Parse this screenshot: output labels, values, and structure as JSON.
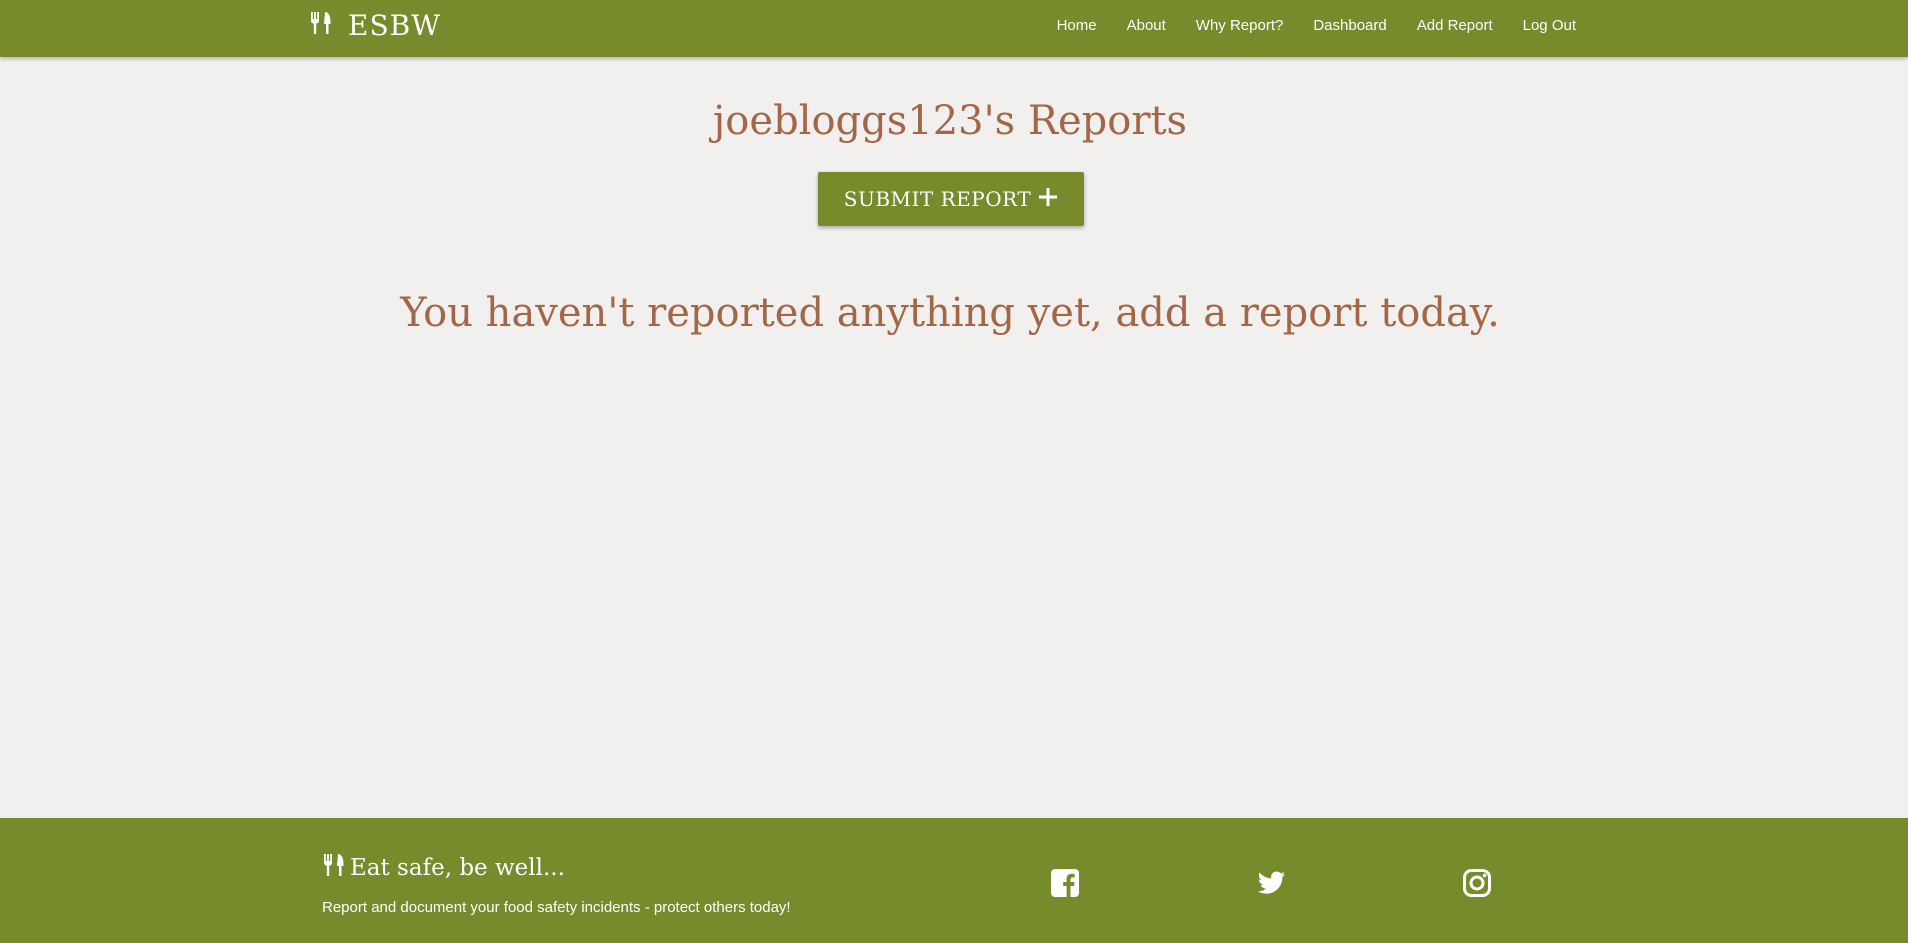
{
  "navbar": {
    "brand_icon": "utensils-icon",
    "brand": "ESBW",
    "links": [
      "Home",
      "About",
      "Why Report?",
      "Dashboard",
      "Add Report",
      "Log Out"
    ]
  },
  "main": {
    "title": "joebloggs123's Reports",
    "submit_label": "SUBMIT REPORT",
    "submit_icon": "plus-icon",
    "empty_message": "You haven't reported anything yet, add a report today."
  },
  "footer": {
    "tagline": "Eat safe, be well...",
    "description": "Report and document your food safety incidents - protect others today!",
    "social_icons": [
      "facebook-icon",
      "twitter-icon",
      "instagram-icon"
    ]
  },
  "colors": {
    "primary": "#778b2c",
    "accent_text": "#a36748",
    "background": "#f2f0ef"
  }
}
